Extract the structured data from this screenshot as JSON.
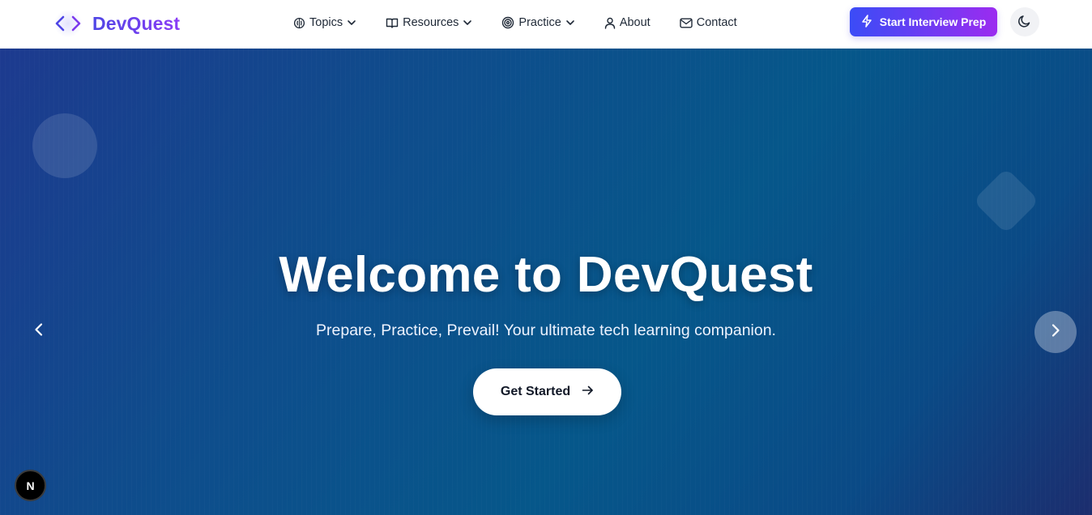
{
  "brand": {
    "name": "DevQuest",
    "icon": "code-brackets-icon"
  },
  "nav": {
    "items": [
      {
        "label": "Topics",
        "icon": "brain-icon",
        "has_dropdown": true
      },
      {
        "label": "Resources",
        "icon": "book-open-icon",
        "has_dropdown": true
      },
      {
        "label": "Practice",
        "icon": "target-icon",
        "has_dropdown": true
      },
      {
        "label": "About",
        "icon": "user-icon",
        "has_dropdown": false
      },
      {
        "label": "Contact",
        "icon": "mail-icon",
        "has_dropdown": false
      }
    ],
    "cta_label": "Start Interview Prep",
    "cta_icon": "lightning-icon",
    "theme_icon": "moon-icon"
  },
  "hero": {
    "title": "Welcome to DevQuest",
    "subtitle": "Prepare, Practice, Prevail! Your ultimate tech learning companion.",
    "button_label": "Get Started",
    "button_icon": "arrow-right-icon",
    "prev_icon": "chevron-left-icon",
    "next_icon": "chevron-right-icon"
  },
  "dev_badge": {
    "label": "N"
  },
  "colors": {
    "brand_gradient_start": "#4f46e5",
    "brand_gradient_end": "#8b3cf6",
    "cta_gradient_start": "#3b4cf6",
    "cta_gradient_end": "#9b2cf0",
    "hero_bg_start": "#1d3a8f",
    "hero_bg_mid": "#06578a",
    "hero_bg_end": "#1c2d6e"
  }
}
